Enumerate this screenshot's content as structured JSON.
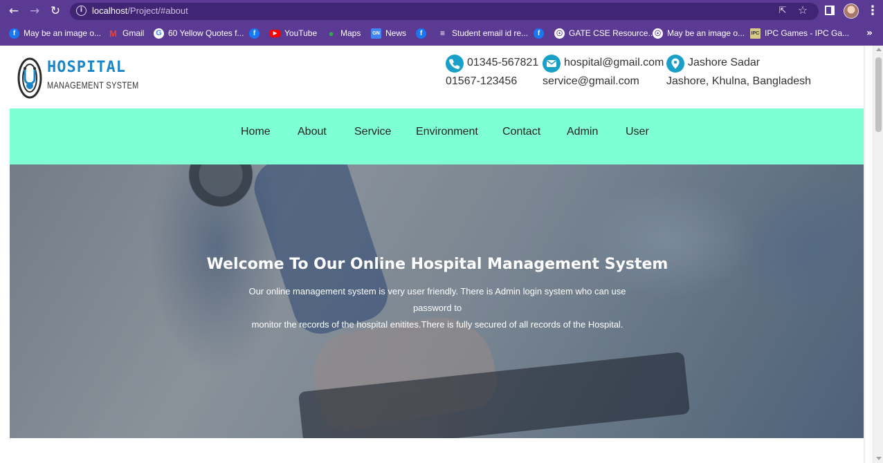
{
  "browser": {
    "url_host": "localhost",
    "url_path": "/Project/#about",
    "bookmarks": [
      {
        "label": "May be an image o...",
        "icon": "facebook-icon"
      },
      {
        "label": "Gmail",
        "icon": "gmail-icon"
      },
      {
        "label": "60 Yellow Quotes f...",
        "icon": "google-icon"
      },
      {
        "label": "",
        "icon": "facebook-icon"
      },
      {
        "label": "YouTube",
        "icon": "youtube-icon"
      },
      {
        "label": "Maps",
        "icon": "maps-icon"
      },
      {
        "label": "News",
        "icon": "news-icon"
      },
      {
        "label": "",
        "icon": "facebook-icon"
      },
      {
        "label": "Student email id re...",
        "icon": "list-icon"
      },
      {
        "label": "",
        "icon": "facebook-icon"
      },
      {
        "label": "GATE CSE Resource...",
        "icon": "globe-icon"
      },
      {
        "label": "May be an image o...",
        "icon": "globe-icon"
      },
      {
        "label": "IPC Games - IPC Ga...",
        "icon": "ipc-icon"
      }
    ],
    "bookmarks_more": "»"
  },
  "site": {
    "logo": {
      "title": "HOSPITAL",
      "subtitle": "MANAGEMENT SYSTEM"
    },
    "contacts": [
      {
        "icon": "phone-icon",
        "line1": "01345-567821",
        "line2": "01567-123456"
      },
      {
        "icon": "mail-icon",
        "line1": "hospital@gmail.com",
        "line2": "service@gmail.com"
      },
      {
        "icon": "location-pin-icon",
        "line1": "Jashore Sadar",
        "line2": "Jashore, Khulna, Bangladesh"
      }
    ],
    "nav": [
      "Home",
      "About",
      "Service",
      "Environment",
      "Contact",
      "Admin",
      "User"
    ],
    "hero": {
      "title": "Welcome To Our Online Hospital Management System",
      "text_line1": "Our online management system is very user friendly. There is Admin login system who can use password to",
      "text_line2": "monitor the records of the hospital enitites.There is fully secured of all records of the Hospital."
    }
  },
  "colors": {
    "browser_chrome": "#5b3a93",
    "navbar_bg": "#7fffd4",
    "accent": "#18a0c9",
    "logo_blue": "#1a86c9"
  }
}
